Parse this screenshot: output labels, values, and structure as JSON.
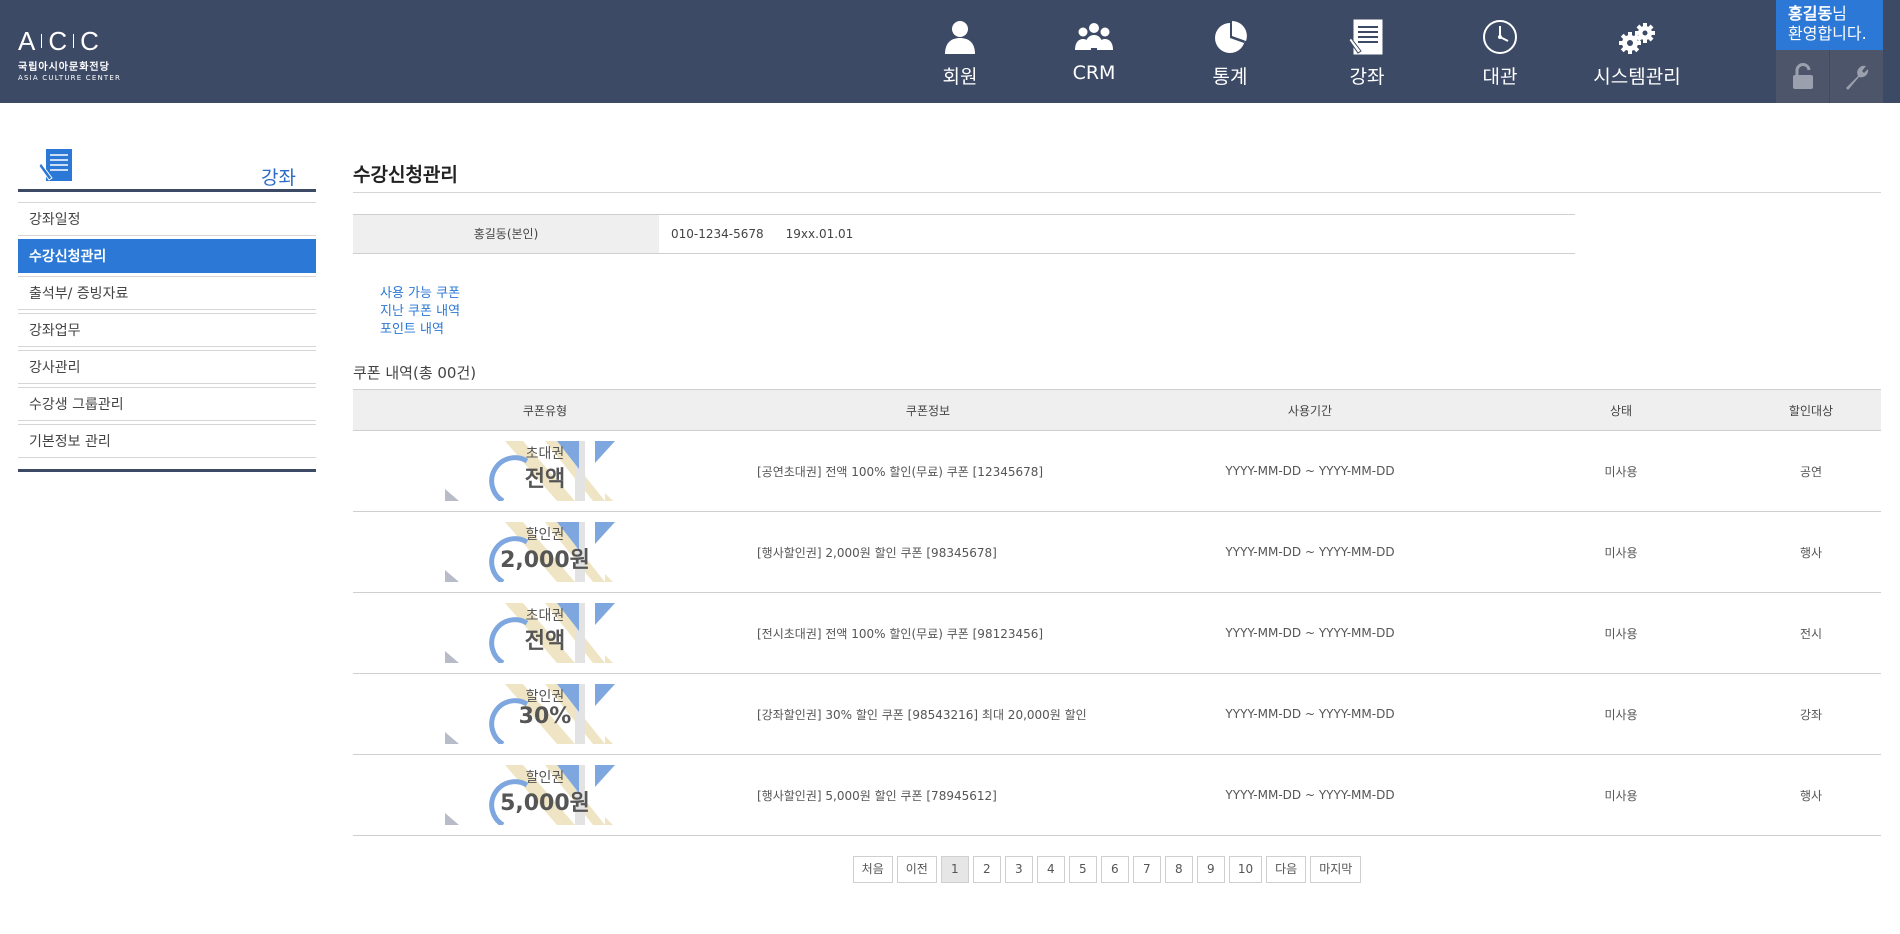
{
  "logo": {
    "main": [
      "A",
      "C",
      "C"
    ],
    "korean": "국립아시아문화전당",
    "english": "ASIA CULTURE CENTER"
  },
  "gnb": [
    {
      "label": "회원",
      "icon": "person-icon"
    },
    {
      "label": "CRM",
      "icon": "group-icon"
    },
    {
      "label": "통계",
      "icon": "pie-chart-icon"
    },
    {
      "label": "강좌",
      "icon": "course-book-icon"
    },
    {
      "label": "대관",
      "icon": "clock-icon"
    },
    {
      "label": "시스템관리",
      "icon": "gears-icon"
    }
  ],
  "user": {
    "name": "홍길동",
    "suffix": "님",
    "greeting": "환영합니다."
  },
  "util": {
    "lock_icon": "unlock-icon",
    "settings_icon": "wrench-icon"
  },
  "sidebar": {
    "title": "강좌",
    "items": [
      {
        "label": "강좌일정",
        "active": false
      },
      {
        "label": "수강신청관리",
        "active": true
      },
      {
        "label": "출석부/ 증빙자료",
        "active": false
      },
      {
        "label": "강좌업무",
        "active": false
      },
      {
        "label": "강사관리",
        "active": false
      },
      {
        "label": "수강생 그룹관리",
        "active": false
      },
      {
        "label": "기본정보 관리",
        "active": false
      }
    ]
  },
  "page": {
    "title": "수강신청관리"
  },
  "member": {
    "name": "홍길동(본인)",
    "phone": "010-1234-5678",
    "birth": "19xx.01.01"
  },
  "links": [
    "사용 가능 쿠폰",
    "지난 쿠폰 내역",
    "포인트 내역"
  ],
  "coupons": {
    "title": "쿠폰 내역(총 00건)",
    "headers": [
      "쿠폰유형",
      "쿠폰정보",
      "사용기간",
      "상태",
      "할인대상"
    ],
    "rows": [
      {
        "type": "초대권",
        "amount": "전액",
        "info": "[공연초대권] 전액 100% 할인(무료) 쿠폰 [12345678]",
        "period": "YYYY-MM-DD ~ YYYY-MM-DD",
        "status": "미사용",
        "target": "공연"
      },
      {
        "type": "할인권",
        "amount": "2,000원",
        "info": "[행사할인권] 2,000원 할인 쿠폰 [98345678]",
        "period": "YYYY-MM-DD ~ YYYY-MM-DD",
        "status": "미사용",
        "target": "행사"
      },
      {
        "type": "초대권",
        "amount": "전액",
        "info": "[전시초대권] 전액 100% 할인(무료) 쿠폰 [98123456]",
        "period": "YYYY-MM-DD ~ YYYY-MM-DD",
        "status": "미사용",
        "target": "전시"
      },
      {
        "type": "할인권",
        "amount": "30%",
        "info": "[강좌할인권] 30% 할인 쿠폰 [98543216] 최대 20,000원 할인",
        "period": "YYYY-MM-DD ~ YYYY-MM-DD",
        "status": "미사용",
        "target": "강좌"
      },
      {
        "type": "할인권",
        "amount": "5,000원",
        "info": "[행사할인권] 5,000원 할인 쿠폰 [78945612]",
        "period": "YYYY-MM-DD ~ YYYY-MM-DD",
        "status": "미사용",
        "target": "행사"
      }
    ]
  },
  "pagination": {
    "first": "처음",
    "prev": "이전",
    "pages": [
      "1",
      "2",
      "3",
      "4",
      "5",
      "6",
      "7",
      "8",
      "9",
      "10"
    ],
    "current": "1",
    "next": "다음",
    "last": "마지막"
  },
  "colors": {
    "header_bg": "#3d4a65",
    "accent_blue": "#2b78d6",
    "util_bg": "#4c5569"
  }
}
